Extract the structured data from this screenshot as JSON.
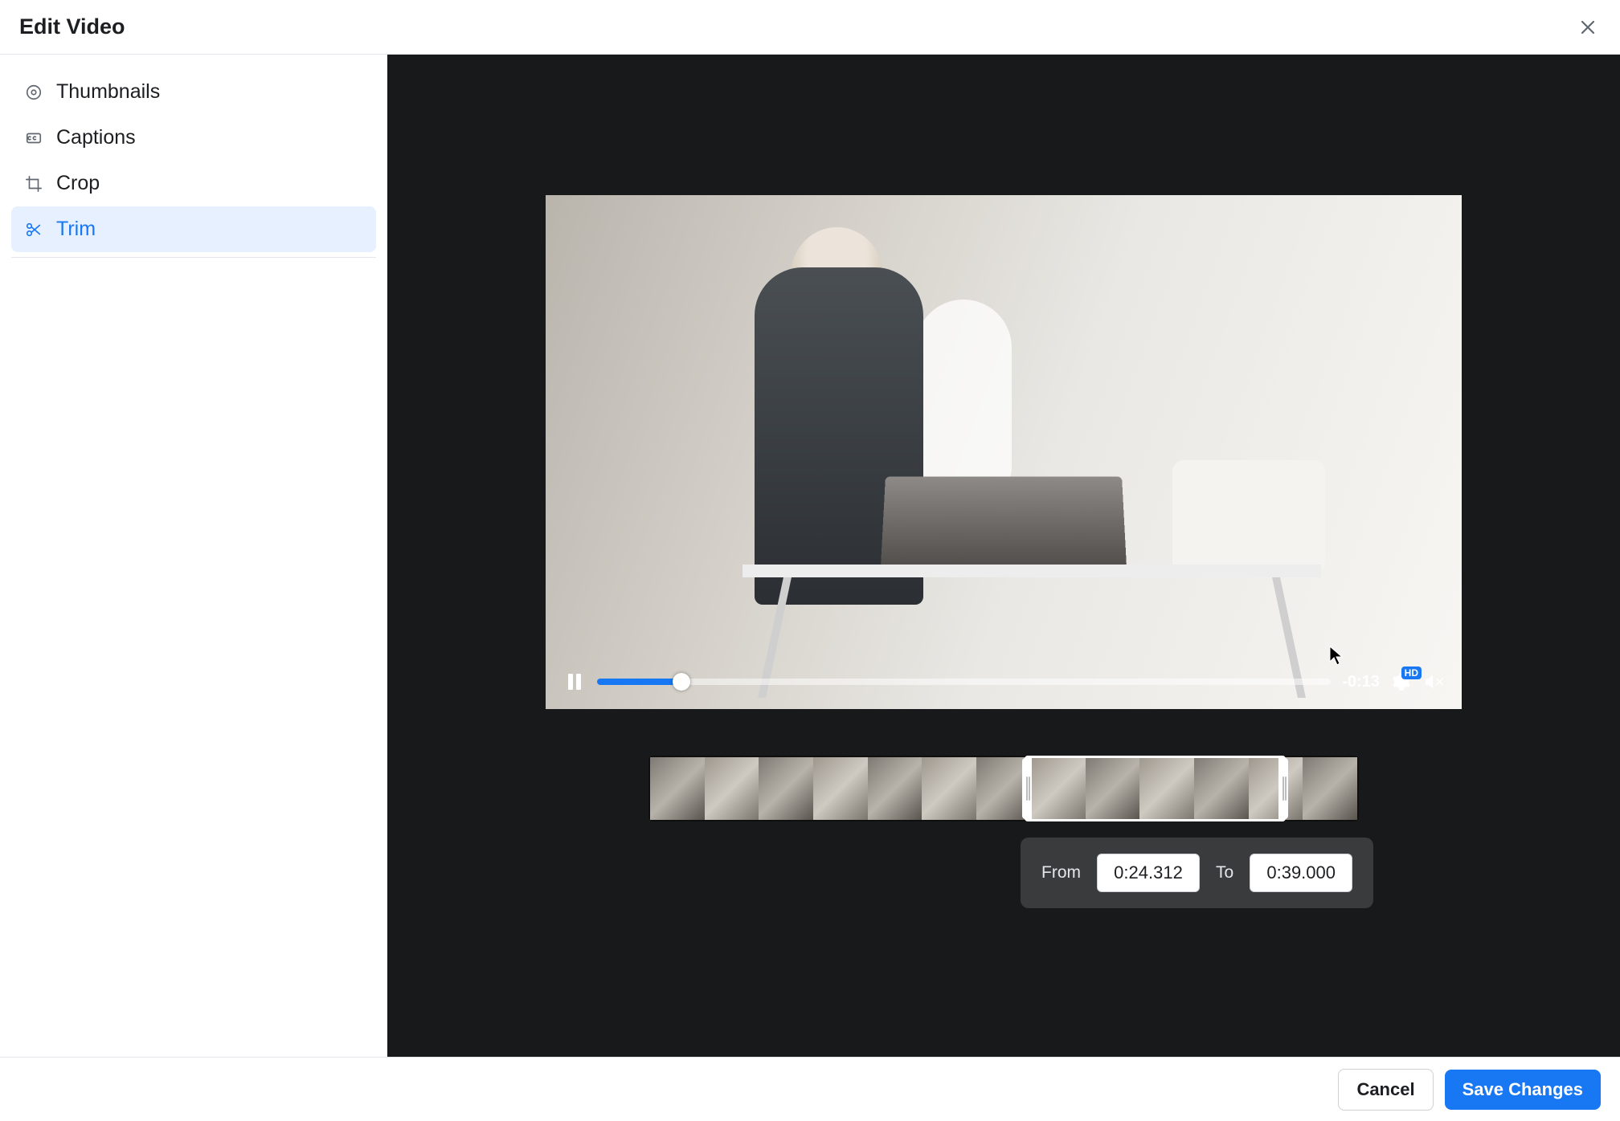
{
  "header": {
    "title": "Edit Video"
  },
  "sidebar": {
    "items": [
      {
        "label": "Thumbnails",
        "icon": "thumbnails"
      },
      {
        "label": "Captions",
        "icon": "captions"
      },
      {
        "label": "Crop",
        "icon": "crop"
      },
      {
        "label": "Trim",
        "icon": "trim",
        "active": true
      }
    ]
  },
  "player": {
    "state": "playing",
    "progress_percent": 11.5,
    "time_remaining": "-0:13",
    "quality_badge": "HD"
  },
  "trim": {
    "from_label": "From",
    "from_value": "0:24.312",
    "to_label": "To",
    "to_value": "0:39.000"
  },
  "footer": {
    "cancel": "Cancel",
    "save": "Save Changes"
  }
}
